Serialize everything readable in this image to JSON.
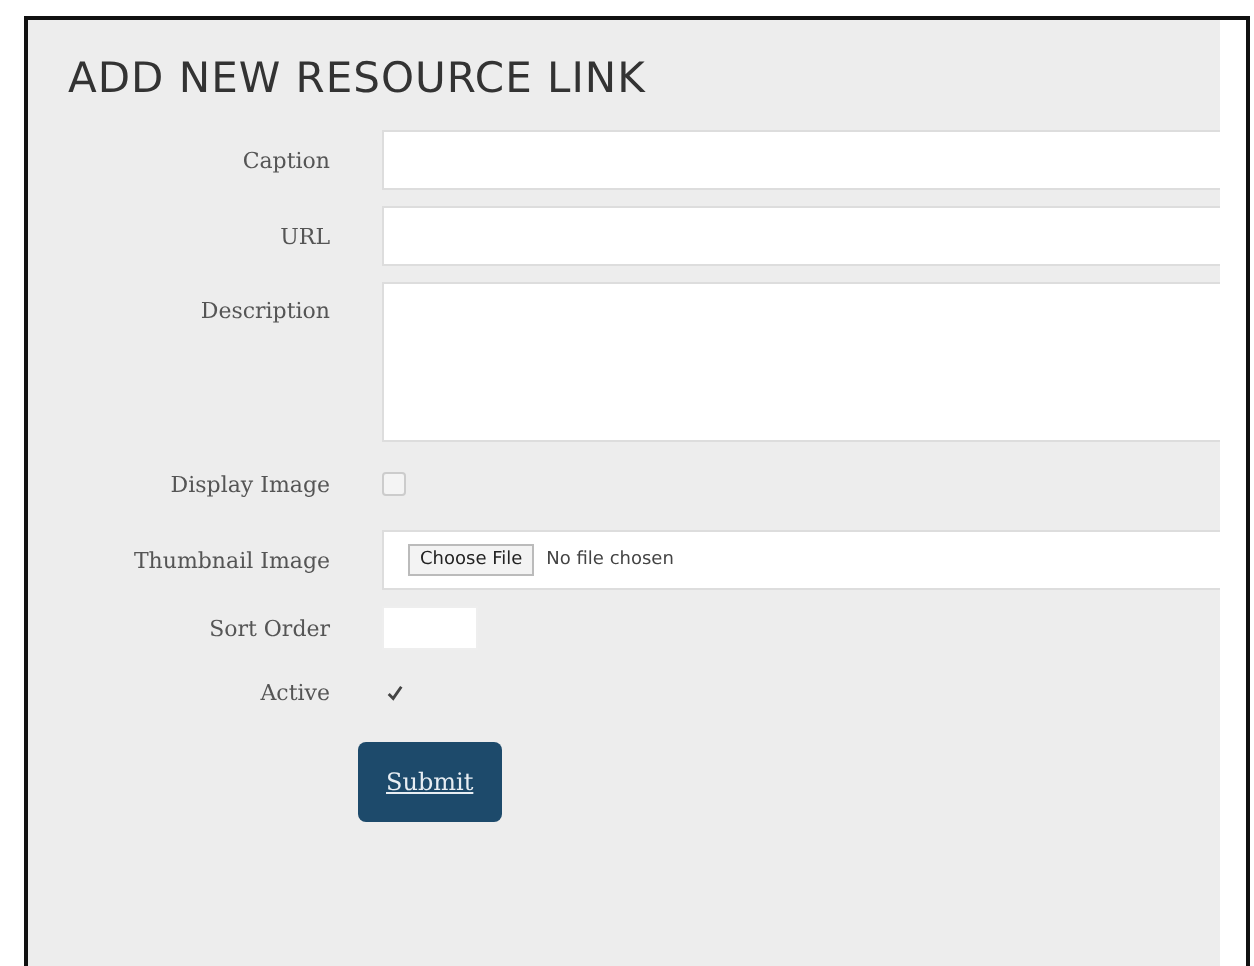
{
  "title": "ADD NEW RESOURCE LINK",
  "fields": [
    {
      "kind": "text",
      "label": "Caption"
    },
    {
      "kind": "text",
      "label": "URL"
    },
    {
      "kind": "textarea",
      "label": "Description"
    },
    {
      "kind": "checkbox",
      "label": "Display Image",
      "checked": false
    },
    {
      "kind": "file",
      "label": "Thumbnail Image",
      "button": "Choose File",
      "status": "No file chosen"
    },
    {
      "kind": "number",
      "label": "Sort Order"
    },
    {
      "kind": "checkbox",
      "label": "Active",
      "checked": true
    }
  ],
  "submit": "Submit"
}
